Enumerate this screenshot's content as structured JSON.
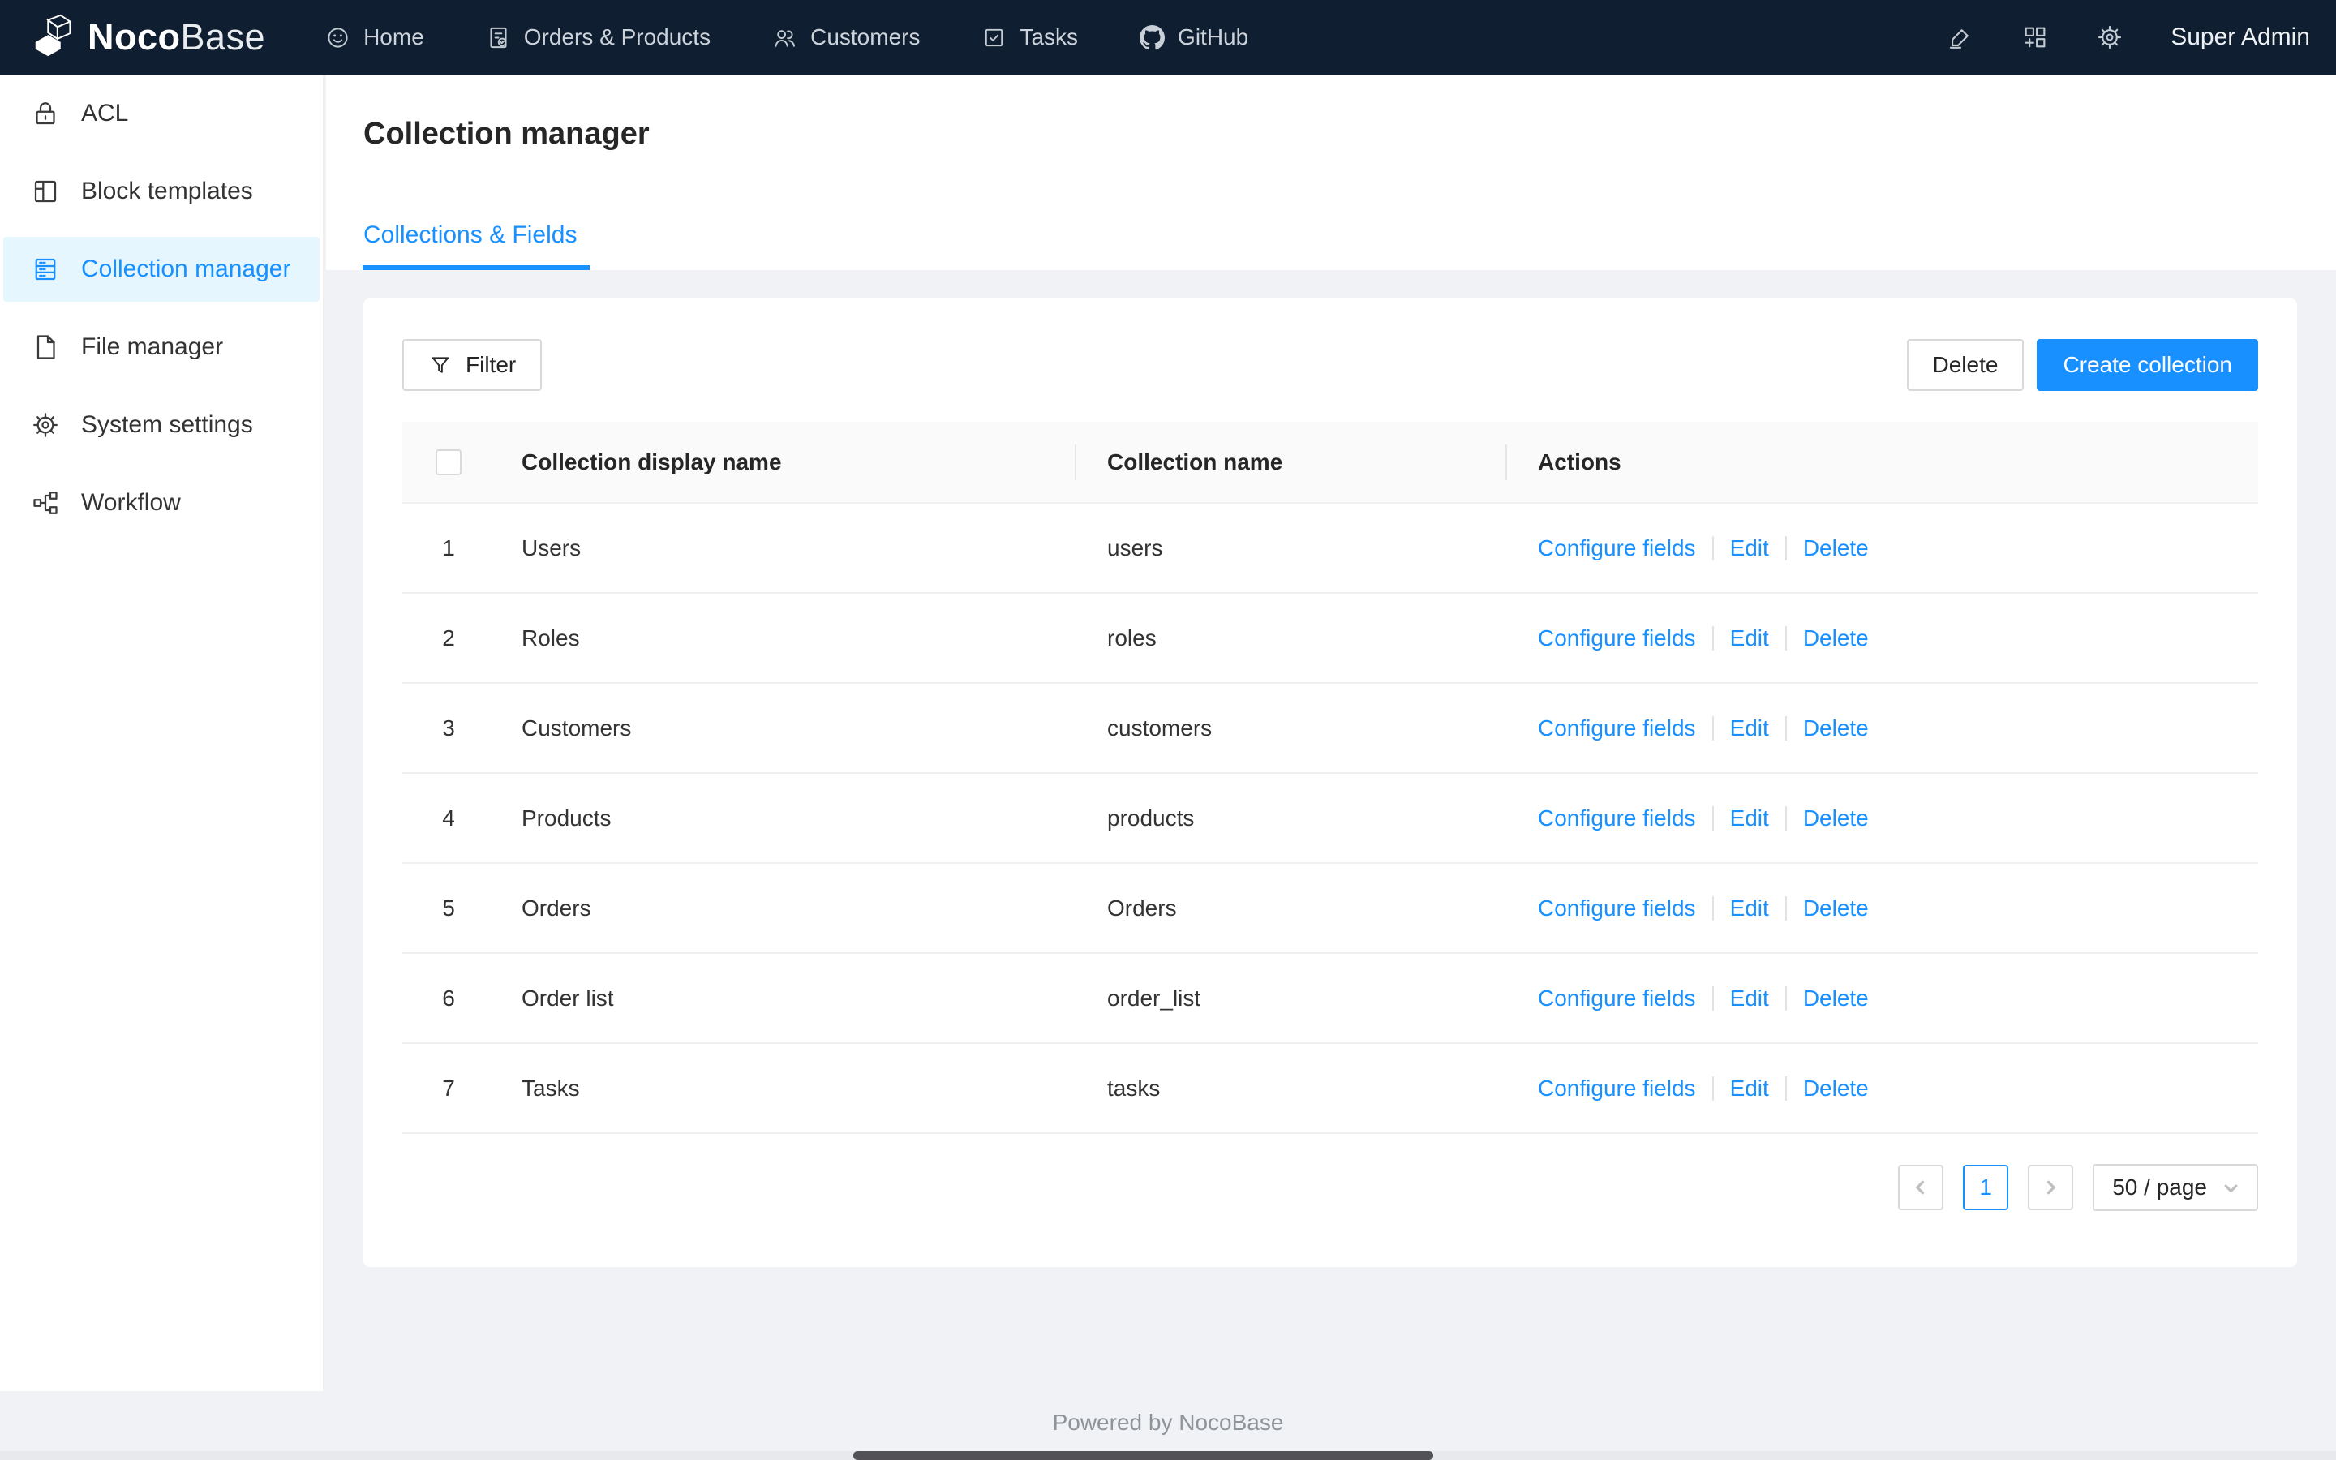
{
  "colors": {
    "accent": "#1890ff",
    "navbar_bg": "#0f1e30",
    "page_bg": "#f0f2f5",
    "selected_item_bg": "#e6f6fe",
    "table_header_bg": "#fafafa"
  },
  "navbar": {
    "logo": {
      "bold": "Noco",
      "light": "Base",
      "icon": "nocobase-cube-logo"
    },
    "items": [
      {
        "label": "Home",
        "icon": "smiley-icon"
      },
      {
        "label": "Orders & Products",
        "icon": "document-check-icon"
      },
      {
        "label": "Customers",
        "icon": "people-icon"
      },
      {
        "label": "Tasks",
        "icon": "check-square-icon"
      },
      {
        "label": "GitHub",
        "icon": "github-icon"
      }
    ],
    "right_icons": [
      "highlighter-icon",
      "appstore-add-icon",
      "gear-icon"
    ],
    "user": "Super Admin"
  },
  "sidebar": {
    "items": [
      {
        "label": "ACL",
        "icon": "lock-icon",
        "selected": false
      },
      {
        "label": "Block templates",
        "icon": "layout-icon",
        "selected": false
      },
      {
        "label": "Collection manager",
        "icon": "database-icon",
        "selected": true
      },
      {
        "label": "File manager",
        "icon": "file-icon",
        "selected": false
      },
      {
        "label": "System settings",
        "icon": "gear-icon",
        "selected": false
      },
      {
        "label": "Workflow",
        "icon": "workflow-icon",
        "selected": false
      }
    ]
  },
  "page": {
    "title": "Collection manager",
    "tab": "Collections & Fields"
  },
  "toolbar": {
    "filter_label": "Filter",
    "delete_label": "Delete",
    "create_label": "Create collection"
  },
  "table": {
    "headers": {
      "display_name": "Collection display name",
      "name": "Collection name",
      "actions": "Actions"
    },
    "actions": {
      "configure": "Configure fields",
      "edit": "Edit",
      "delete": "Delete"
    },
    "rows": [
      {
        "index": "1",
        "display_name": "Users",
        "name": "users"
      },
      {
        "index": "2",
        "display_name": "Roles",
        "name": "roles"
      },
      {
        "index": "3",
        "display_name": "Customers",
        "name": "customers"
      },
      {
        "index": "4",
        "display_name": "Products",
        "name": "products"
      },
      {
        "index": "5",
        "display_name": "Orders",
        "name": "Orders"
      },
      {
        "index": "6",
        "display_name": "Order list",
        "name": "order_list"
      },
      {
        "index": "7",
        "display_name": "Tasks",
        "name": "tasks"
      }
    ]
  },
  "pagination": {
    "current": "1",
    "page_size": "50 / page"
  },
  "footer": {
    "text": "Powered by NocoBase"
  }
}
